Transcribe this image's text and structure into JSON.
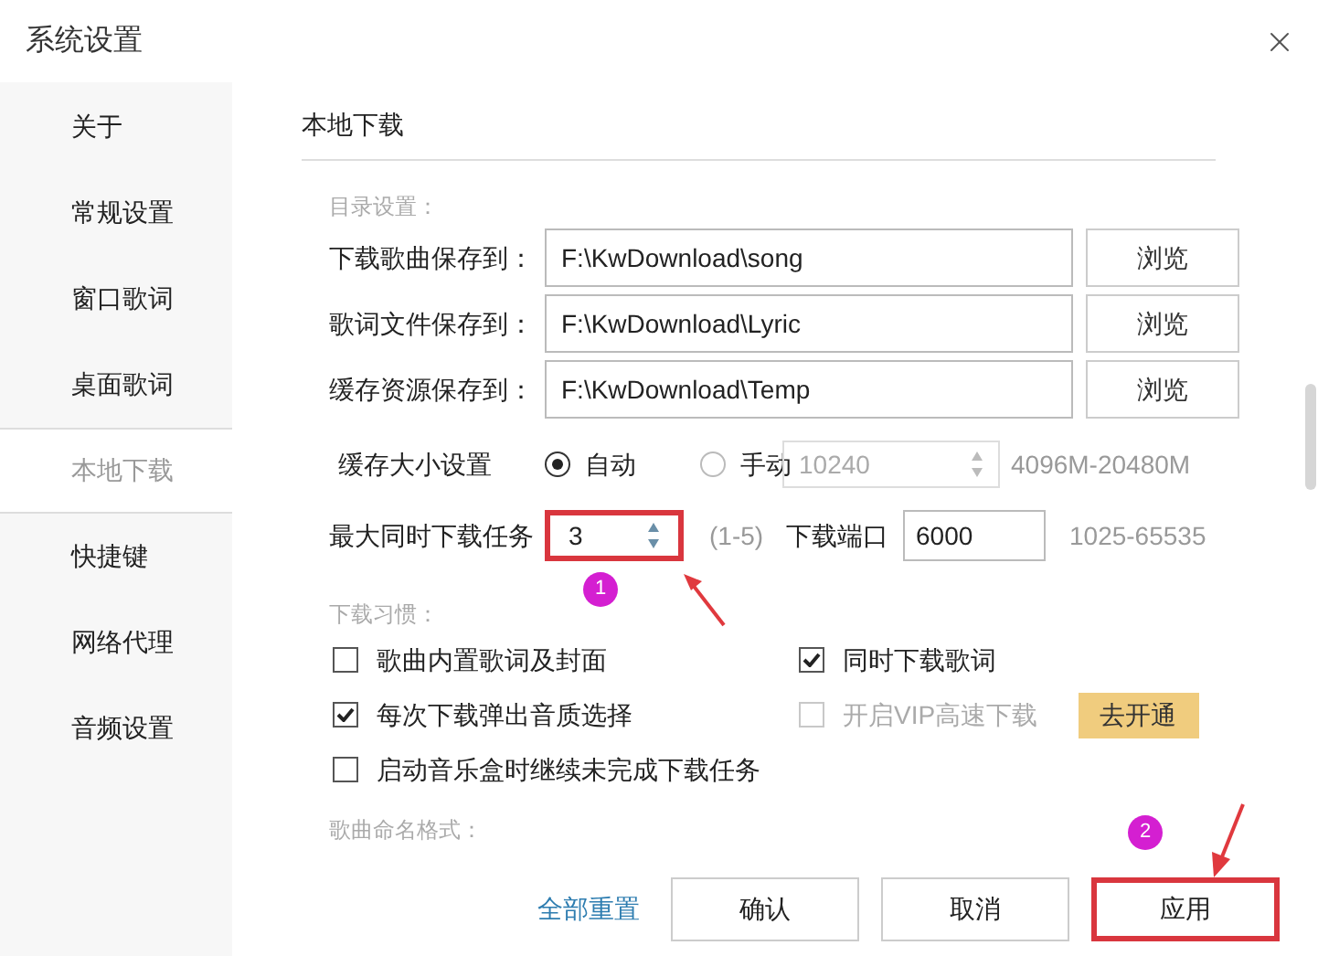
{
  "window": {
    "title": "系统设置"
  },
  "sidebar": {
    "items": [
      {
        "label": "关于",
        "selected": false
      },
      {
        "label": "常规设置",
        "selected": false
      },
      {
        "label": "窗口歌词",
        "selected": false
      },
      {
        "label": "桌面歌词",
        "selected": false
      },
      {
        "label": "本地下载",
        "selected": true
      },
      {
        "label": "快捷键",
        "selected": false
      },
      {
        "label": "网络代理",
        "selected": false
      },
      {
        "label": "音频设置",
        "selected": false
      }
    ]
  },
  "section_title": "本地下载",
  "directory": {
    "heading": "目录设置：",
    "rows": [
      {
        "label": "下载歌曲保存到：",
        "value": "F:\\KwDownload\\song",
        "button": "浏览"
      },
      {
        "label": "歌词文件保存到：",
        "value": "F:\\KwDownload\\Lyric",
        "button": "浏览"
      },
      {
        "label": "缓存资源保存到：",
        "value": "F:\\KwDownload\\Temp",
        "button": "浏览"
      }
    ]
  },
  "cache": {
    "label": "缓存大小设置",
    "options": [
      {
        "label": "自动",
        "selected": true
      },
      {
        "label": "手动",
        "selected": false
      }
    ],
    "size_field": {
      "value": "10240",
      "disabled": true
    },
    "size_range": "4096M-20480M"
  },
  "max_tasks": {
    "label": "最大同时下载任务",
    "value": "3",
    "range": "(1-5)",
    "highlighted": true
  },
  "port": {
    "label": "下载端口",
    "value": "6000",
    "range": "1025-65535"
  },
  "habits": {
    "heading": "下载习惯：",
    "options": [
      {
        "label": "歌曲内置歌词及封面",
        "checked": false,
        "disabled": false
      },
      {
        "label": "同时下载歌词",
        "checked": true,
        "disabled": false
      },
      {
        "label": "每次下载弹出音质选择",
        "checked": true,
        "disabled": false
      },
      {
        "label": "开启VIP高速下载",
        "checked": false,
        "disabled": true,
        "action": "去开通"
      },
      {
        "label": "启动音乐盒时继续未完成下载任务",
        "checked": false,
        "disabled": false
      }
    ]
  },
  "naming": {
    "heading": "歌曲命名格式："
  },
  "footer": {
    "reset_link": "全部重置",
    "buttons": [
      {
        "label": "确认",
        "highlighted": false
      },
      {
        "label": "取消",
        "highlighted": false
      },
      {
        "label": "应用",
        "highlighted": true
      }
    ]
  },
  "annotations": [
    {
      "text": "1"
    },
    {
      "text": "2"
    }
  ]
}
